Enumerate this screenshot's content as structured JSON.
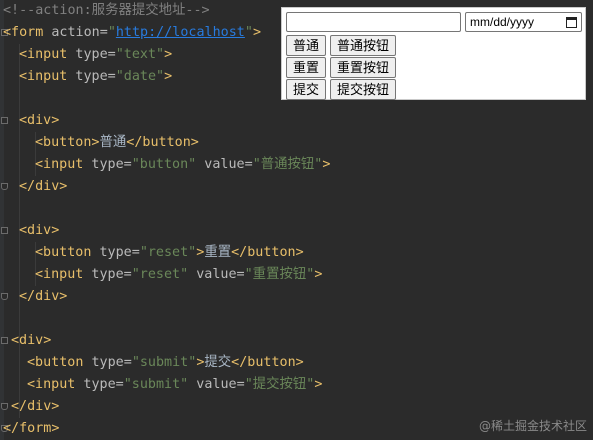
{
  "code": {
    "comment": "<!--action:服务器提交地址-->",
    "form_open_tag": "<form",
    "form_action_attr": " action=",
    "form_action_q1": "\"",
    "form_action_url": "http://localhost",
    "form_action_q2": "\"",
    "form_open_close": ">",
    "input_text_tag": "<input",
    "input_text_attr": " type=",
    "input_text_val": "\"text\"",
    "input_text_end": ">",
    "input_date_tag": "<input",
    "input_date_attr": " type=",
    "input_date_val": "\"date\"",
    "input_date_end": ">",
    "div1_open": "<div>",
    "btn1_open": "<button>",
    "btn1_text": "普通",
    "btn1_close": "</button>",
    "inp1_tag": "<input",
    "inp1_attr1": " type=",
    "inp1_val1": "\"button\"",
    "inp1_attr2": " value=",
    "inp1_val2": "\"普通按钮\"",
    "inp1_end": ">",
    "div1_close": "</div>",
    "div2_open": "<div>",
    "btn2_tag": "<button",
    "btn2_attr": " type=",
    "btn2_val": "\"reset\"",
    "btn2_gt": ">",
    "btn2_text": "重置",
    "btn2_close": "</button>",
    "inp2_tag": "<input",
    "inp2_attr1": " type=",
    "inp2_val1": "\"reset\"",
    "inp2_attr2": " value=",
    "inp2_val2": "\"重置按钮\"",
    "inp2_end": ">",
    "div2_close": "</div>",
    "div3_open": "<div>",
    "btn3_tag": "<button",
    "btn3_attr": " type=",
    "btn3_val": "\"submit\"",
    "btn3_gt": ">",
    "btn3_text": "提交",
    "btn3_close": "</button>",
    "inp3_tag": "<input",
    "inp3_attr1": " type=",
    "inp3_val1": "\"submit\"",
    "inp3_attr2": " value=",
    "inp3_val2": "\"提交按钮\"",
    "inp3_end": ">",
    "div3_close": "</div>",
    "form_close": "</form>"
  },
  "preview": {
    "text_input_value": "",
    "date_placeholder": "mm/dd/yyyy",
    "button_plain": "普通",
    "input_button": "普通按钮",
    "button_reset": "重置",
    "input_reset": "重置按钮",
    "button_submit": "提交",
    "input_submit": "提交按钮"
  },
  "watermark": "@稀土掘金技术社区",
  "colors": {
    "background": "#2b2b2b",
    "tag": "#e8bf6a",
    "attribute": "#bababa",
    "string": "#6a8759",
    "url": "#287bde",
    "comment": "#808080",
    "text": "#a9b7c6"
  }
}
